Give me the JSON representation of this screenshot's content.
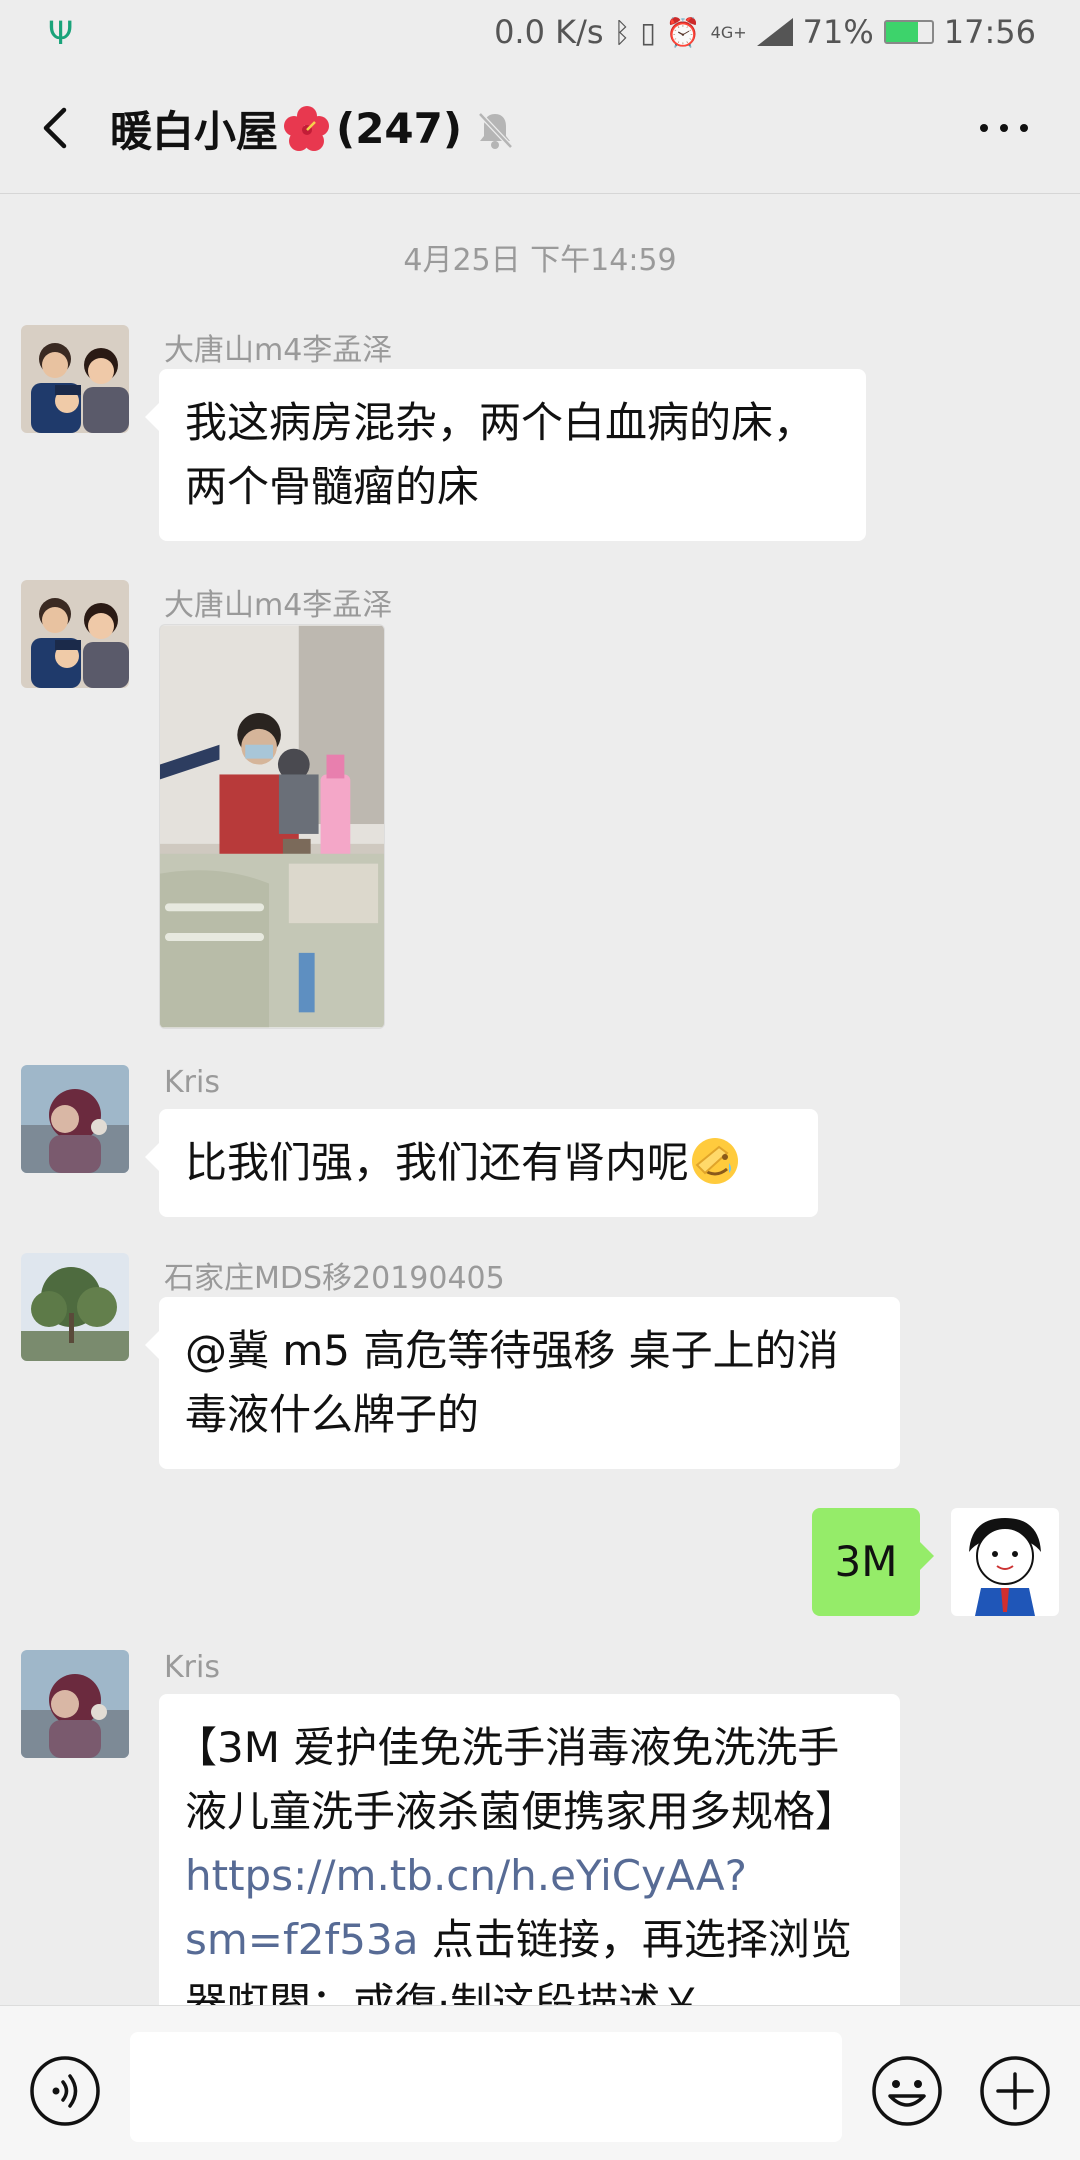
{
  "status_bar": {
    "usb_icon": "usb-icon",
    "net_speed": "0.0 K/s",
    "network": "4G+",
    "battery": "71%",
    "battery_level": 0.71,
    "time": "17:56"
  },
  "header": {
    "title": "暖白小屋",
    "member_count": "(247)",
    "icons": [
      "back-icon",
      "hibiscus-icon",
      "mute-icon",
      "more-icon"
    ]
  },
  "chat": {
    "timestamp": "4月25日 下午14:59",
    "messages": [
      {
        "sender": "大唐山m4李孟泽",
        "lines": [
          "我这病房混杂，两个白血病的床，",
          "两个骨髓瘤的床"
        ]
      },
      {
        "sender": "大唐山m4李孟泽",
        "type": "image"
      },
      {
        "sender": "Kris",
        "text": "比我们强，我们还有肾内呢"
      },
      {
        "sender": "石家庄MDS移20190405",
        "lines": [
          "@冀 m5 高危等待强移  桌子上的消",
          "毒液什么牌子的"
        ]
      },
      {
        "mine": true,
        "text": "3M"
      },
      {
        "sender": "Kris",
        "line1": "【3M 爱护佳免洗手消毒液免洗洗手",
        "line2": "液儿童洗手液杀菌便携家用多规格】",
        "link1": "https://m.tb.cn/h.eYiCyAA?",
        "link2": "sm=f2f53a",
        "line3_tail": " 点击链接，再选择浏览",
        "line4": "器咑閞；或復·制这段描述￥"
      }
    ]
  },
  "input_bar": {
    "placeholder": "",
    "icons": [
      "voice-icon",
      "emoji-icon",
      "plus-icon"
    ]
  },
  "colors": {
    "background": "#ededed",
    "my_bubble": "#95ec69",
    "link": "#576b95",
    "battery": "#3dd36b"
  }
}
